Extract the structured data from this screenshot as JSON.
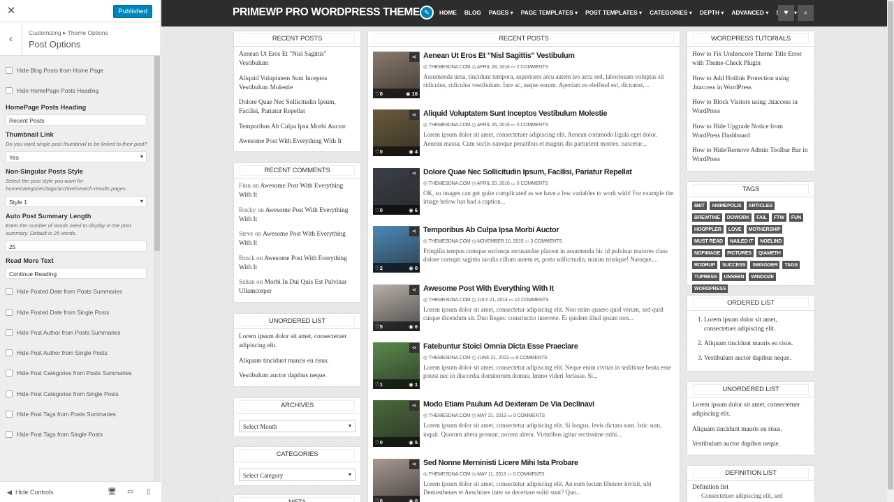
{
  "customizer": {
    "close_icon": "close-icon",
    "publish_label": "Published",
    "breadcrumb": [
      "Customizing",
      "Theme Options"
    ],
    "section_title": "Post Options",
    "hide_controls_label": "Hide Controls",
    "cb_top": [
      "Hide Blog Posts from Home Page",
      "Hide HomePage Posts Heading"
    ],
    "homepage_heading_label": "HomePage Posts Heading",
    "homepage_heading_value": "Recent Posts",
    "thumb_link_label": "Thumbnail Link",
    "thumb_link_desc": "Do you want single post thumbnail to be linked to their post?",
    "thumb_link_value": "Yes",
    "nonsingular_label": "Non-Singular Posts Style",
    "nonsingular_desc": "Select the post style you want for home/categories/tags/archive/search-results pages.",
    "nonsingular_value": "Style 1",
    "summary_len_label": "Auto Post Summary Length",
    "summary_len_desc": "Enter the number of words need to display in the post summary. Default is 25 words.",
    "summary_len_value": "25",
    "read_more_label": "Read More Text",
    "read_more_value": "Continue Reading",
    "cb_bottom": [
      "Hide Posted Date from Posts Summaries",
      "Hide Posted Date from Single Posts",
      "Hide Post Author from Posts Summaries",
      "Hide Post Author from Single Posts",
      "Hide Post Categories from Posts Summaries",
      "Hide Post Categories from Single Posts",
      "Hide Post Tags from Posts Summaries",
      "Hide Post Tags from Single Posts"
    ]
  },
  "site": {
    "brand": "PRIMEWP PRO WORDPRESS THEME",
    "nav": [
      "HOME",
      "BLOG",
      "PAGES",
      "PAGE TEMPLATES",
      "POST TEMPLATES",
      "CATEGORIES",
      "DEPTH",
      "ADVANCED",
      "SHOP"
    ],
    "nav_caret": [
      false,
      false,
      true,
      true,
      true,
      true,
      true,
      true,
      true
    ]
  },
  "left_sidebar": {
    "recent_posts_title": "RECENT POSTS",
    "recent_posts": [
      "Aenean Ut Eros Et \"Nisl Sagittis\" Vestibulum",
      "Aliquid Voluptatem Sunt Inceptos Vestibulum Molestie",
      "Dolore Quae Nec Sollicitudin Ipsum, Facilisi, Pariatur Repellat",
      "Temporibus Ab Culpa Ipsa Morbi Auctor",
      "Awesome Post With Everything With It"
    ],
    "recent_comments_title": "RECENT COMMENTS",
    "recent_comments": [
      {
        "author": "Finn",
        "on": "on",
        "post": "Awesome Post With Everything With It"
      },
      {
        "author": "Rocky",
        "on": "on",
        "post": "Awesome Post With Everything With It"
      },
      {
        "author": "Steve",
        "on": "on",
        "post": "Awesome Post With Everything With It"
      },
      {
        "author": "Brock",
        "on": "on",
        "post": "Awesome Post With Everything With It"
      },
      {
        "author": "Sahan",
        "on": "on",
        "post": "Morbi In Dui Quis Est Pulvinar Ullamcorper"
      }
    ],
    "unordered_title": "UNORDERED LIST",
    "unordered": [
      "Lorem ipsum dolor sit amet, consectetuer adipiscing elit.",
      "Aliquam tincidunt mauris eu risus.",
      "Vestibulum auctor dapibus neque."
    ],
    "archives_title": "ARCHIVES",
    "archives_select": "Select Month",
    "categories_title": "CATEGORIES",
    "categories_select": "Select Category",
    "meta_title": "META"
  },
  "main": {
    "title": "RECENT POSTS",
    "posts": [
      {
        "title": "Aenean Ut Eros Et \"Nisl Sagittis\" Vestibulum",
        "author": "THEMESDNA.COM",
        "date": "APRIL 28, 2016",
        "comments": "2 COMMENTS",
        "likes": "8",
        "views": "16",
        "excerpt": "Assumenda urna, tincidunt tempora, asperiores arcu autem leo arcu sed, laboriosam voluptas sit ridiculus, ridiculus vestibulum. Iure ac, neque earum. Aperiam ea eleifend est, dictumst,...",
        "img": "#8a7a6a"
      },
      {
        "title": "Aliquid Voluptatem Sunt Inceptos Vestibulum Molestie",
        "author": "THEMESDNA.COM",
        "date": "APRIL 26, 2016",
        "comments": "0 COMMENTS",
        "likes": "0",
        "views": "4",
        "excerpt": "Lorem ipsum dolor sit amet, consectetuer adipiscing elit. Aenean commodo ligula eget dolor. Aenean massa. Cum sociis natoque penatibus et magnis dis parturient montes, nascetur...",
        "img": "#6b5a3a"
      },
      {
        "title": "Dolore Quae Nec Sollicitudin Ipsum, Facilisi, Pariatur Repellat",
        "author": "THEMESDNA.COM",
        "date": "APRIL 20, 2016",
        "comments": "0 COMMENTS",
        "likes": "0",
        "views": "6",
        "excerpt": "OK, so images can get quite complicated as we have a few variables to work with! For example the image below has had a caption...",
        "img": "#3a3f48"
      },
      {
        "title": "Temporibus Ab Culpa Ipsa Morbi Auctor",
        "author": "THEMESDNA.COM",
        "date": "NOVEMBER 10, 2015",
        "comments": "3 COMMENTS",
        "likes": "2",
        "views": "0",
        "excerpt": "Fringilla tempus cumque sociosqu recusandae placeat in assumenda hic id pulvinar maiores class dolore corrupti sagittis iaculis cillum autem et, porta sollicitudin, minim tristique! Natoque,...",
        "img": "#4a8ab8"
      },
      {
        "title": "Awesome Post With Everything With It",
        "author": "THEMESDNA.COM",
        "date": "JULY 21, 2014",
        "comments": "12 COMMENTS",
        "likes": "5",
        "views": "6",
        "excerpt": "Lorem ipsum dolor sit amet, consectetur adipiscing elit. Non enim quaero quid verum, sed quid cuique dicendum sit. Duo Reges: constructio interrete. Et quidem illud ipsum non...",
        "img": "#b8b0a8"
      },
      {
        "title": "Fatebuntur Stoici Omnia Dicta Esse Praeclare",
        "author": "THEMESDNA.COM",
        "date": "JUNE 21, 2013",
        "comments": "0 COMMENTS",
        "likes": "1",
        "views": "1",
        "excerpt": "Lorem ipsum dolor sit amet, consectetur adipiscing elit. Neque enim civitas in seditione beata esse potest nec in discordia dominorum domus; Immo videri fortasse. Si...",
        "img": "#5a8a4a"
      },
      {
        "title": "Modo Etiam Paulum Ad Dexteram De Via Declinavi",
        "author": "THEMESDNA.COM",
        "date": "MAY 21, 2013",
        "comments": "0 COMMENTS",
        "likes": "0",
        "views": "5",
        "excerpt": "Lorem ipsum dolor sit amet, consectetur adipiscing elit. Si longus, levis dictata sunt. Istic sum, inquit. Quorum altera prosunt, nocent altera. Virtutibus igitur rectissime mihi...",
        "img": "#4a6a3a"
      },
      {
        "title": "Sed Nonne Merninisti Licere Mihi Ista Probare",
        "author": "THEMESDNA.COM",
        "date": "MAY 11, 2013",
        "comments": "0 COMMENTS",
        "likes": "0",
        "views": "0",
        "excerpt": "Lorem ipsum dolor sit amet, consectetur adipiscing elit. An eum locum libenter invisit, ubi Demosthenes et Aeschines inter se decertare soliti sunt? Quo...",
        "img": "#a89890"
      }
    ]
  },
  "right_sidebar": {
    "tutorials_title": "WORDPRESS TUTORIALS",
    "tutorials": [
      "How to Fix Underscore Theme Title Error with Theme-Check Plugin",
      "How to Add Hotlink Protection using .htaccess in WordPress",
      "How to Block Visitors using .htaccess in WordPress",
      "How to Hide Upgrade Notice from WordPress Dashboard",
      "How to Hide/Remove Admin Toolbar Bar in WordPress"
    ],
    "tags_title": "TAGS",
    "tags": [
      "8BIT",
      "ANIMEPOLIS",
      "ARTICLES",
      "BREWTINE",
      "DOWORK",
      "FAIL",
      "FTW",
      "FUN",
      "HOOPPLER",
      "LOVE",
      "MOTHERSHIP",
      "MUST READ",
      "NAILED IT",
      "NOELIND",
      "NOFIMAGE",
      "PICTURES",
      "QIAMETH",
      "RODRUP",
      "SUCCESS",
      "SWAGGER",
      "TAGS",
      "TUPRESS",
      "UNSEEN",
      "WINDOZE",
      "WORDPRESS"
    ],
    "ordered_title": "ORDERED LIST",
    "ordered": [
      "Lorem ipsum dolor sit amet, consectetuer adipiscing elit.",
      "Aliquam tincidunt mauris eu risus.",
      "Vestibulum auctor dapibus neque."
    ],
    "unordered_title": "UNORDERED LIST",
    "unordered": [
      "Lorem ipsum dolor sit amet, consectetuer adipiscing elit.",
      "Aliquam tincidunt mauris eu risus.",
      "Vestibulum auctor dapibus neque."
    ],
    "definition_title": "DEFINITION LIST",
    "definition_term": "Definition list",
    "definition_desc": "Consectetuer adipiscing elit, sed"
  }
}
